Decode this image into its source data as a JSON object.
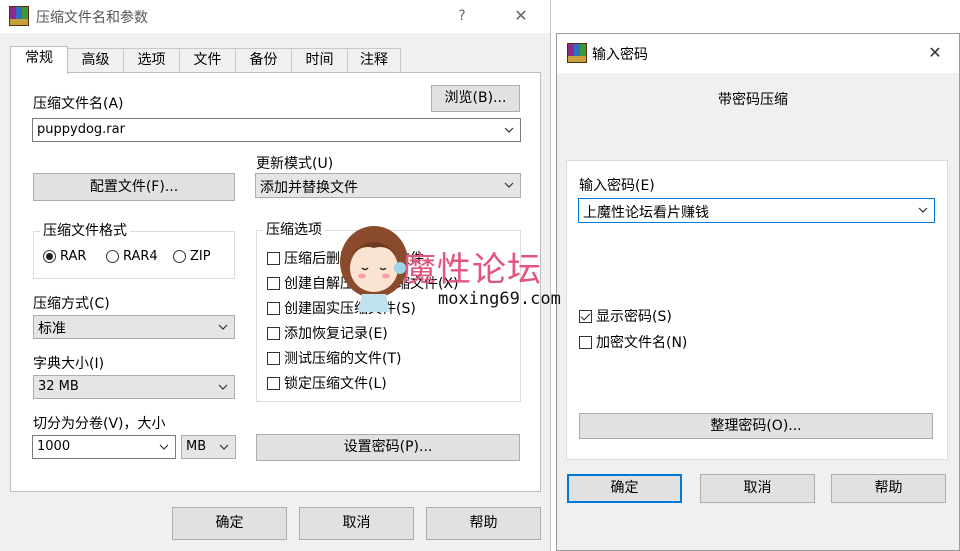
{
  "main_dialog": {
    "title": "压缩文件名和参数",
    "help_button": "?",
    "close_button": "✕",
    "tabs": [
      "常规",
      "高级",
      "选项",
      "文件",
      "备份",
      "时间",
      "注释"
    ],
    "archive_name_label": "压缩文件名(A)",
    "browse_button": "浏览(B)...",
    "archive_name_value": "puppydog.rar",
    "update_mode_label": "更新模式(U)",
    "update_mode_value": "添加并替换文件",
    "profiles_button": "配置文件(F)...",
    "format_group": {
      "title": "压缩文件格式",
      "options": [
        "RAR",
        "RAR4",
        "ZIP"
      ],
      "selected": "RAR"
    },
    "options_group": {
      "title": "压缩选项",
      "items": [
        "压缩后删除原来的文件",
        "创建自解压格式压缩文件(X)",
        "创建固实压缩文件(S)",
        "添加恢复记录(E)",
        "测试压缩的文件(T)",
        "锁定压缩文件(L)"
      ]
    },
    "method_label": "压缩方式(C)",
    "method_value": "标准",
    "dict_label": "字典大小(I)",
    "dict_value": "32 MB",
    "split_label": "切分为分卷(V)，大小",
    "split_value": "1000",
    "split_unit": "MB",
    "set_password_button": "设置密码(P)...",
    "ok_button": "确定",
    "cancel_button": "取消",
    "help_bottom_button": "帮助"
  },
  "password_dialog": {
    "title": "输入密码",
    "close_button": "✕",
    "subtitle": "带密码压缩",
    "enter_password_label": "输入密码(E)",
    "password_value": "上魔性论坛看片赚钱",
    "show_password_label": "显示密码(S)",
    "show_password_checked": true,
    "encrypt_names_label": "加密文件名(N)",
    "encrypt_names_checked": false,
    "organize_button": "整理密码(O)...",
    "ok_button": "确定",
    "cancel_button": "取消",
    "help_button": "帮助"
  },
  "watermark": {
    "text": "魔性论坛",
    "url": "moxing69.com"
  },
  "colors": {
    "focus_border": "#0078d7",
    "watermark_pink": "#e0567f",
    "dialog_bg": "#f0f0f0"
  }
}
